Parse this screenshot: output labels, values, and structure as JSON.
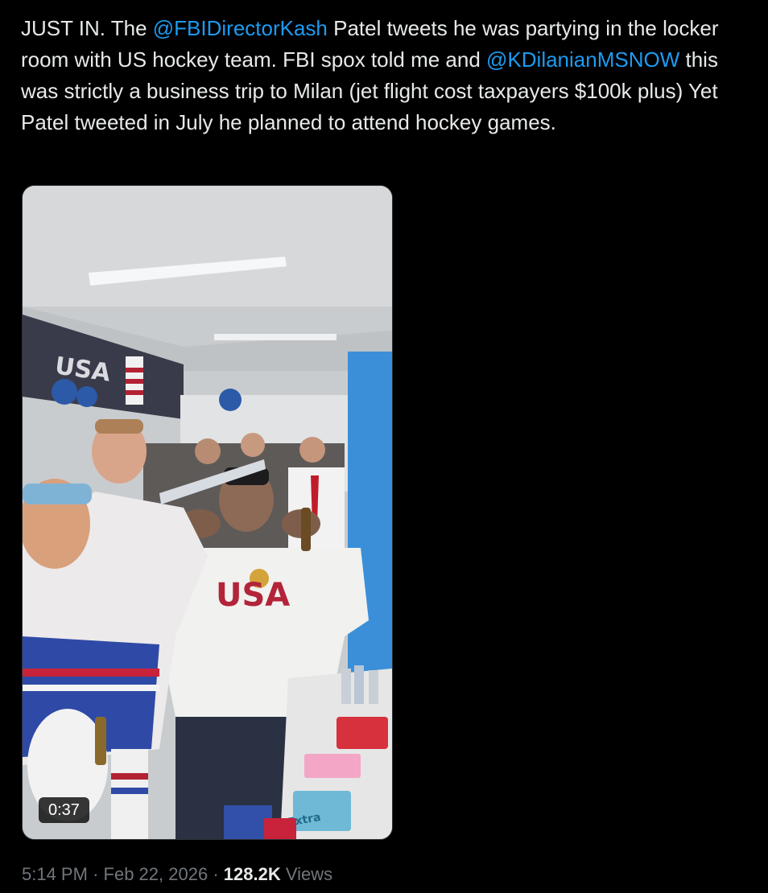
{
  "tweet": {
    "text_1": "JUST IN. The ",
    "mention_1": "@FBIDirectorKash",
    "text_2": " Patel tweets he was partying in the locker room with US hockey team. FBI spox told me and ",
    "mention_2": "@KDilanianMSNOW",
    "text_3": " this was strictly a business trip to Milan (jet flight cost taxpayers $100k plus) Yet Patel tweeted in July he planned to attend hockey games."
  },
  "media": {
    "duration": "0:37",
    "wall_sign": "USA",
    "jersey_lettering": "USA",
    "product_label": "Extra"
  },
  "meta": {
    "time": "5:14 PM",
    "separator": "·",
    "date": "Feb 22, 2026",
    "views_count": "128.2K",
    "views_label": "Views"
  },
  "colors": {
    "background": "#000000",
    "text": "#e7e9ea",
    "mention": "#1d9bf0",
    "muted": "#71767b"
  }
}
